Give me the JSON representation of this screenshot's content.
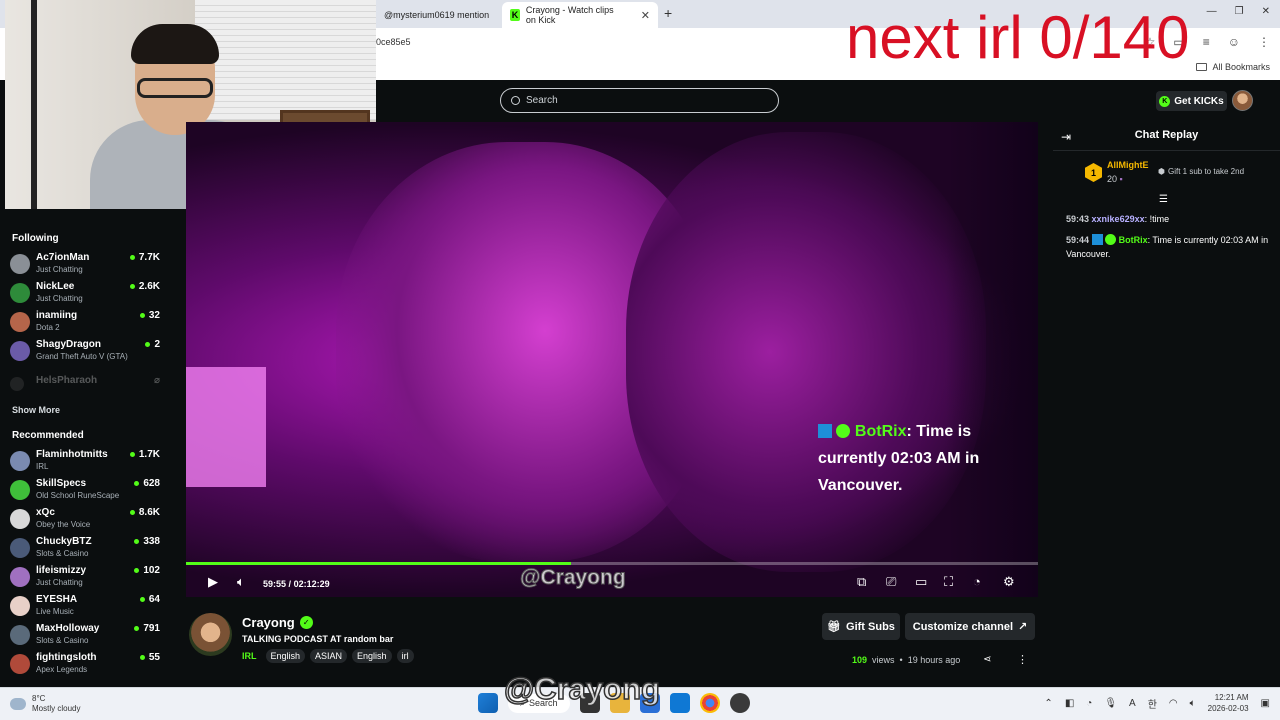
{
  "browser": {
    "tabs": [
      {
        "label": "@mysterium0619 mention"
      },
      {
        "label": "Crayong - Watch clips on Kick"
      }
    ],
    "new_tab": "+",
    "url_fragment": "0ce85e5",
    "all_bookmarks": "All Bookmarks"
  },
  "overlay_title": "next irl 0/140",
  "header": {
    "search_placeholder": "Search",
    "get_kicks_label": "Get KICKs"
  },
  "sidebar": {
    "following_heading": "Following",
    "following": [
      {
        "name": "Ac7ionMan",
        "category": "Just Chatting",
        "viewers": "7.7K",
        "avatar_color": "#8a8f96"
      },
      {
        "name": "NickLee",
        "category": "Just Chatting",
        "viewers": "2.6K",
        "avatar_color": "#2e8b3a"
      },
      {
        "name": "inamiing",
        "category": "Dota 2",
        "viewers": "32",
        "avatar_color": "#b5654a"
      },
      {
        "name": "ShagyDragon",
        "category": "Grand Theft Auto V (GTA)",
        "viewers": "2",
        "avatar_color": "#6b5ba8"
      }
    ],
    "offline_name": "HelsPharaoh",
    "show_more": "Show More",
    "recommended_heading": "Recommended",
    "recommended": [
      {
        "name": "Flaminhotmitts",
        "category": "IRL",
        "viewers": "1.7K",
        "avatar_color": "#7a8ab0"
      },
      {
        "name": "SkillSpecs",
        "category": "Old School RuneScape",
        "viewers": "628",
        "avatar_color": "#3fbf3a"
      },
      {
        "name": "xQc",
        "category": "Obey the Voice",
        "viewers": "8.6K",
        "avatar_color": "#d8d8d8"
      },
      {
        "name": "ChuckyBTZ",
        "category": "Slots & Casino",
        "viewers": "338",
        "avatar_color": "#4a5a78"
      },
      {
        "name": "lifeismizzy",
        "category": "Just Chatting",
        "viewers": "102",
        "avatar_color": "#a070c0"
      },
      {
        "name": "EYESHA",
        "category": "Live Music",
        "viewers": "64",
        "avatar_color": "#e8d0c8"
      },
      {
        "name": "MaxHolloway",
        "category": "Slots & Casino",
        "viewers": "791",
        "avatar_color": "#5a6a7a"
      },
      {
        "name": "fightingsloth",
        "category": "Apex Legends",
        "viewers": "55",
        "avatar_color": "#b04a3a"
      }
    ]
  },
  "video": {
    "chat_overlay": {
      "user": "BotRix",
      "message": ": Time is currently 02:03 AM in Vancouver."
    },
    "time_current": "59:55",
    "time_separator": "/",
    "time_total": "02:12:29",
    "progress_fraction": 0.452,
    "watermark": "@Crayong"
  },
  "chat": {
    "title": "Chat Replay",
    "top_gifter": {
      "name": "AllMightE",
      "count": "20",
      "rank": "1"
    },
    "gift_cta": "Gift 1 sub to take 2nd",
    "messages": [
      {
        "time": "59:43",
        "user": "xxnike629xx",
        "user_color": "#b7b0ff",
        "text": "!time"
      },
      {
        "time": "59:44",
        "user": "BotRix",
        "user_color": "#53fc18",
        "text": "Time is currently 02:03 AM in Vancouver."
      }
    ]
  },
  "channel": {
    "name": "Crayong",
    "stream_title": "TALKING PODCAST AT random bar",
    "category": "IRL",
    "tags": [
      "English",
      "ASIAN",
      "English",
      "irl"
    ],
    "gift_subs_label": "Gift Subs",
    "customize_label": "Customize channel",
    "views_count": "109",
    "views_label": "views",
    "separator": "•",
    "posted": "19 hours ago"
  },
  "taskbar": {
    "weather_temp": "8°C",
    "weather_desc": "Mostly cloudy",
    "search_label": "Search",
    "watermark": "@Crayong",
    "time": "12:21 AM",
    "date": "2026-02-03"
  },
  "colors": {
    "kick_green": "#53fc18",
    "overlay_red": "#d81024",
    "background": "#0b0e0f"
  }
}
